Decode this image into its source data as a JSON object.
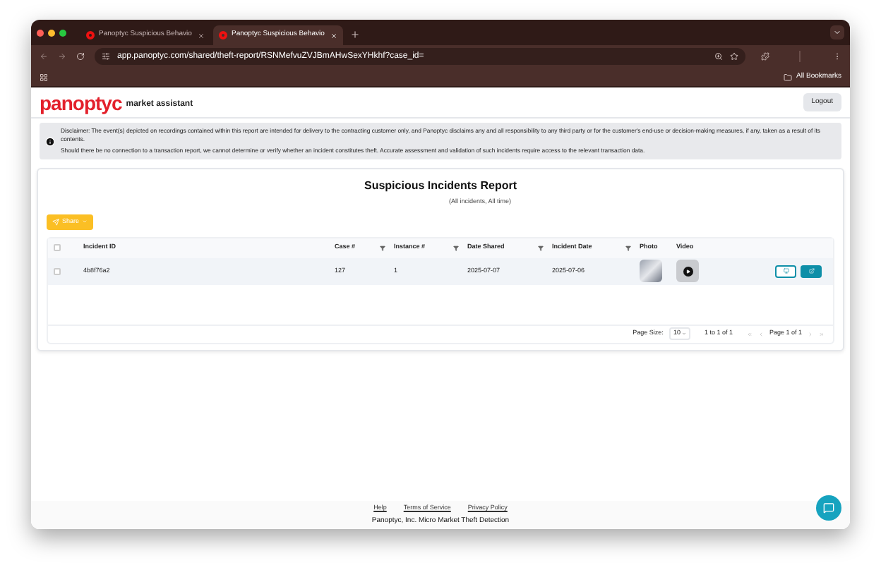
{
  "browser": {
    "tabs": [
      {
        "title": "Panoptyc Suspicious Behavio",
        "selected": false
      },
      {
        "title": "Panoptyc Suspicious Behavio",
        "selected": true
      }
    ],
    "url": "app.panoptyc.com/shared/theft-report/RSNMefvuZVJBmAHwSexYHkhf?case_id=",
    "bookmarks": "All Bookmarks"
  },
  "header": {
    "logo": "panoptyc",
    "subtitle": "market assistant",
    "logout": "Logout"
  },
  "disclaimer": [
    "Disclaimer: The event(s) depicted on recordings contained within this report are intended for delivery to the contracting customer only, and Panoptyc disclaims any and all responsibility to any third party or for the customer's end-use or decision-making measures, if any, taken as a result of its contents.",
    "Should there be no connection to a transaction report, we cannot determine or verify whether an incident constitutes theft. Accurate assessment and validation of such incidents require access to the relevant transaction data."
  ],
  "report": {
    "title": "Suspicious Incidents Report",
    "subtitle": "(All incidents, All time)",
    "share": "Share",
    "select_all_checked": false,
    "columns": [
      {
        "label": "Incident ID",
        "filter": false
      },
      {
        "label": "Case #",
        "filter": true
      },
      {
        "label": "Instance #",
        "filter": true
      },
      {
        "label": "Date Shared",
        "filter": true
      },
      {
        "label": "Incident Date",
        "filter": true
      },
      {
        "label": "Photo",
        "filter": false
      },
      {
        "label": "Video",
        "filter": false
      }
    ],
    "rows": [
      {
        "checked": false,
        "incident_id": "4b8f76a2",
        "case": "127",
        "instance": "1",
        "date_shared": "2025-07-07",
        "incident_date": "2025-07-06"
      }
    ],
    "pagination": {
      "page_size_label": "Page Size:",
      "page_size": "10",
      "range": "1 to 1 of 1",
      "page": "Page 1 of 1"
    }
  },
  "footer": {
    "links": [
      "Help",
      "Terms of Service",
      "Privacy Policy"
    ],
    "company": "Panoptyc, Inc. Micro Market Theft Detection"
  }
}
